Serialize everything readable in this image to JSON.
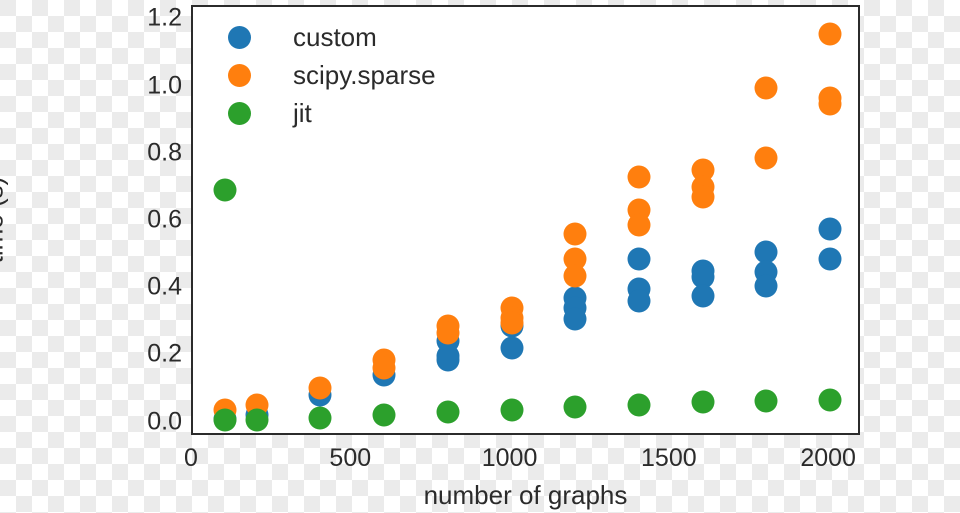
{
  "chart_data": {
    "type": "scatter",
    "title": "",
    "xlabel": "number of graphs",
    "ylabel": "time (s)",
    "xlim": [
      0,
      2100
    ],
    "ylim": [
      -0.04,
      1.24
    ],
    "xticks": [
      0,
      500,
      1000,
      1500,
      2000
    ],
    "xticklabels": [
      "0",
      "500",
      "1000",
      "1500",
      "2000"
    ],
    "yticks": [
      0.0,
      0.2,
      0.4,
      0.6,
      0.8,
      1.0,
      1.2
    ],
    "yticklabels": [
      "0.0",
      "0.2",
      "0.4",
      "0.6",
      "0.8",
      "1.0",
      "1.2"
    ],
    "grid": false,
    "legend_position": "upper left",
    "marker_size": 23,
    "series": [
      {
        "name": "custom",
        "color": "#1f77b4",
        "points": [
          [
            100,
            0.015
          ],
          [
            200,
            0.025
          ],
          [
            400,
            0.085
          ],
          [
            600,
            0.145
          ],
          [
            800,
            0.245
          ],
          [
            800,
            0.2
          ],
          [
            800,
            0.19
          ],
          [
            1000,
            0.29
          ],
          [
            1000,
            0.225
          ],
          [
            1200,
            0.375
          ],
          [
            1200,
            0.345
          ],
          [
            1200,
            0.31
          ],
          [
            1400,
            0.49
          ],
          [
            1400,
            0.4
          ],
          [
            1400,
            0.365
          ],
          [
            1600,
            0.455
          ],
          [
            1600,
            0.435
          ],
          [
            1600,
            0.38
          ],
          [
            1800,
            0.51
          ],
          [
            1800,
            0.45
          ],
          [
            1800,
            0.41
          ],
          [
            2000,
            0.58
          ],
          [
            2000,
            0.49
          ]
        ]
      },
      {
        "name": "scipy.sparse",
        "color": "#ff7f0e",
        "points": [
          [
            100,
            0.04
          ],
          [
            200,
            0.055
          ],
          [
            400,
            0.105
          ],
          [
            600,
            0.19
          ],
          [
            600,
            0.165
          ],
          [
            800,
            0.29
          ],
          [
            800,
            0.27
          ],
          [
            1000,
            0.345
          ],
          [
            1000,
            0.315
          ],
          [
            1000,
            0.3
          ],
          [
            1200,
            0.565
          ],
          [
            1200,
            0.49
          ],
          [
            1200,
            0.44
          ],
          [
            1400,
            0.735
          ],
          [
            1400,
            0.635
          ],
          [
            1400,
            0.59
          ],
          [
            1600,
            0.755
          ],
          [
            1600,
            0.705
          ],
          [
            1600,
            0.675
          ],
          [
            1800,
            1.0
          ],
          [
            1800,
            0.79
          ],
          [
            2000,
            1.16
          ],
          [
            2000,
            0.97
          ],
          [
            2000,
            0.95
          ]
        ]
      },
      {
        "name": "jit",
        "color": "#2ca02c",
        "points": [
          [
            100,
            0.695
          ],
          [
            100,
            0.01
          ],
          [
            200,
            0.012
          ],
          [
            400,
            0.018
          ],
          [
            600,
            0.025
          ],
          [
            800,
            0.035
          ],
          [
            1000,
            0.04
          ],
          [
            1200,
            0.05
          ],
          [
            1400,
            0.055
          ],
          [
            1600,
            0.065
          ],
          [
            1800,
            0.068
          ],
          [
            2000,
            0.07
          ]
        ]
      }
    ]
  }
}
